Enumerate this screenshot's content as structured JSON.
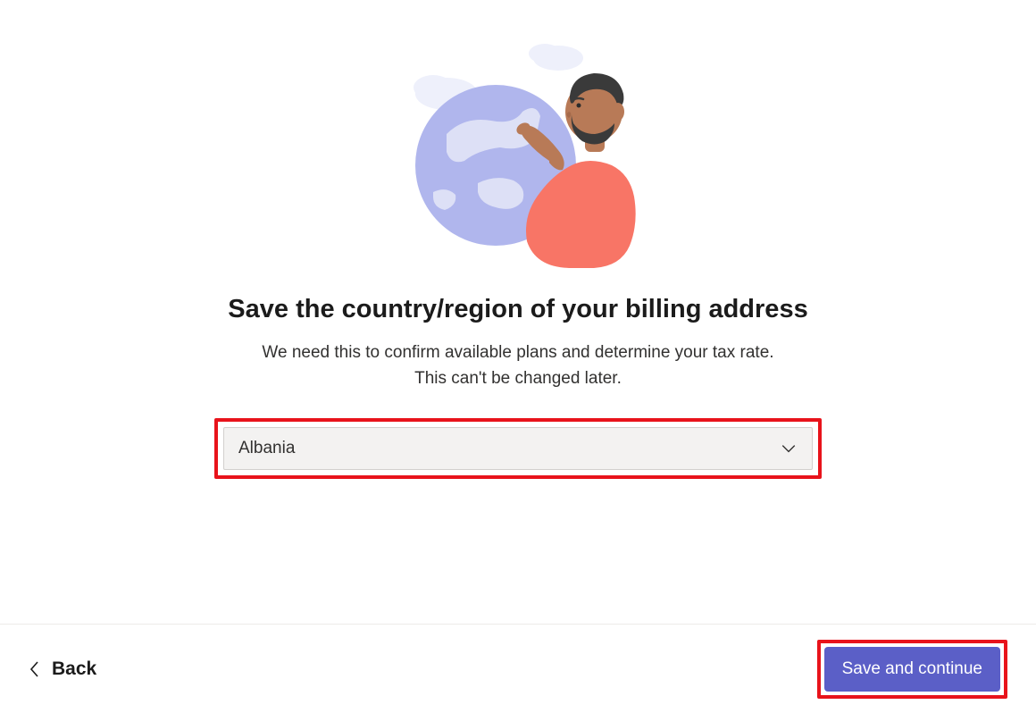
{
  "content": {
    "heading": "Save the country/region of your billing address",
    "subtext_line1": "We need this to confirm available plans and determine your tax rate.",
    "subtext_line2": "This can't be changed later."
  },
  "dropdown": {
    "selected_value": "Albania"
  },
  "footer": {
    "back_label": "Back",
    "primary_label": "Save and continue"
  },
  "colors": {
    "highlight_border": "#e8131b",
    "primary_button": "#5b5fc7"
  }
}
